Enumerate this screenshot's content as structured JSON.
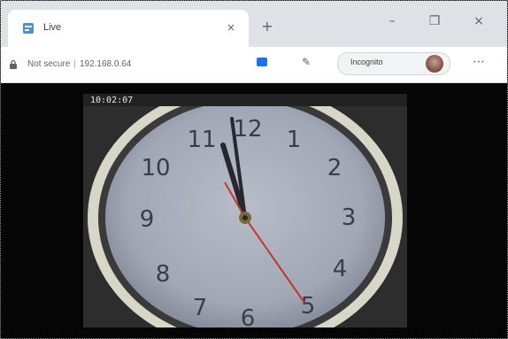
{
  "browser": {
    "tab": {
      "title": "Live",
      "favicon": "page-icon",
      "close": "×"
    },
    "new_tab": "+",
    "window_controls": {
      "minimize": "–",
      "maximize": "❐",
      "close": "×"
    },
    "toolbar": {
      "url_secure": "Not secure",
      "url_host": "192.168.0.64",
      "incognito": "Incognito",
      "menu": "⋯"
    }
  },
  "video": {
    "timestamp": "10:02:07",
    "clock_numerals": [
      "10",
      "9",
      "8",
      "7",
      "6",
      "2",
      "3",
      "4",
      "5",
      "12",
      "1",
      "11"
    ]
  },
  "colors": {
    "accent": "#1a73e8",
    "second_hand": "#c0392b"
  }
}
